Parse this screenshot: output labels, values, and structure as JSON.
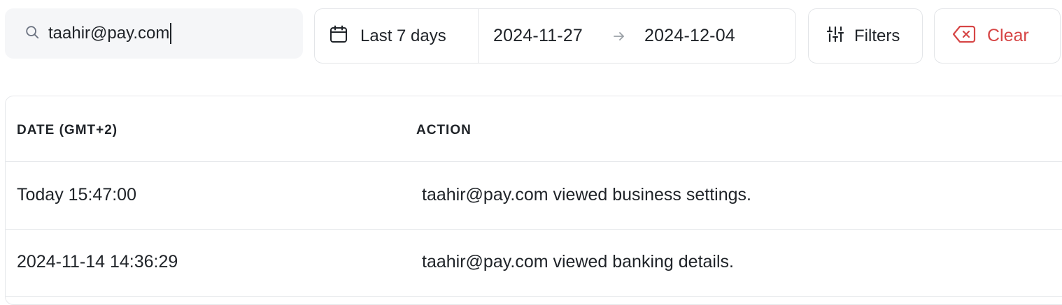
{
  "search": {
    "value": "taahir@pay.com",
    "icon": "search-icon"
  },
  "date_range": {
    "preset_label": "Last 7 days",
    "start": "2024-11-27",
    "end": "2024-12-04",
    "icons": [
      "calendar-icon",
      "arrow-right-icon"
    ]
  },
  "filters": {
    "label": "Filters",
    "icon": "sliders-icon"
  },
  "clear": {
    "label": "Clear",
    "icon": "backspace-x-icon",
    "color": "#d64545"
  },
  "table": {
    "columns": [
      "DATE (GMT+2)",
      "ACTION"
    ],
    "rows": [
      {
        "date": "Today 15:47:00",
        "action": "taahir@pay.com viewed business settings."
      },
      {
        "date": "2024-11-14 14:36:29",
        "action": "taahir@pay.com viewed banking details."
      }
    ]
  }
}
